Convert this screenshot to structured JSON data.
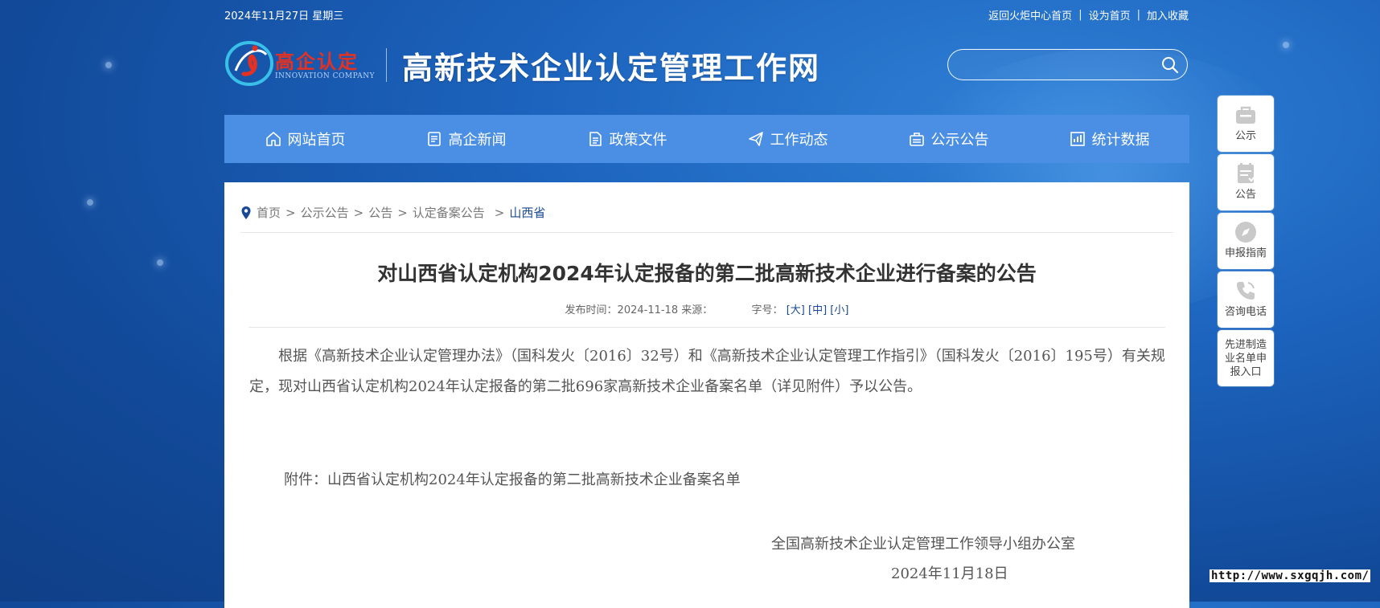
{
  "topbar": {
    "date": "2024年11月27日 星期三",
    "links": [
      "返回火炬中心首页",
      "设为首页",
      "加入收藏"
    ],
    "separator": "|"
  },
  "header": {
    "logo_text": "高企认定",
    "logo_sub": "INNOVATION COMPANY",
    "site_title": "高新技术企业认定管理工作网",
    "search_placeholder": ""
  },
  "nav": {
    "items": [
      {
        "label": "网站首页",
        "icon": "home-icon"
      },
      {
        "label": "高企新闻",
        "icon": "news-icon"
      },
      {
        "label": "政策文件",
        "icon": "document-icon"
      },
      {
        "label": "工作动态",
        "icon": "paper-plane-icon"
      },
      {
        "label": "公示公告",
        "icon": "announcement-icon"
      },
      {
        "label": "统计数据",
        "icon": "chart-icon"
      }
    ]
  },
  "breadcrumb": {
    "items": [
      "首页",
      "公示公告",
      "公告",
      "认定备案公告"
    ],
    "current": "山西省",
    "separator": ">"
  },
  "article": {
    "title": "对山西省认定机构2024年认定报备的第二批高新技术企业进行备案的公告",
    "meta_publish_label": "发布时间：",
    "meta_publish_date": "2024-11-18",
    "meta_source_label": "来源：",
    "meta_font_label": "字号：",
    "font_sizes": [
      "[大]",
      "[中]",
      "[小]"
    ],
    "paragraph": "根据《高新技术企业认定管理办法》（国科发火〔2016〕32号）和《高新技术企业认定管理工作指引》（国科发火〔2016〕195号）有关规定，现对山西省认定机构2024年认定报备的第二批696家高新技术企业备案名单（详见附件）予以公告。",
    "attachment_label": "附件：",
    "attachment_link": "山西省认定机构2024年认定报备的第二批高新技术企业备案名单",
    "signature_org": "全国高新技术企业认定管理工作领导小组办公室",
    "signature_date": "2024年11月18日"
  },
  "sidebar": {
    "items": [
      {
        "label": "公示",
        "icon": "briefcase-icon"
      },
      {
        "label": "公告",
        "icon": "notice-board-icon"
      },
      {
        "label": "申报指南",
        "icon": "compass-icon"
      },
      {
        "label": "咨询电话",
        "icon": "phone-icon"
      },
      {
        "label": "先进制造业名单申报入口",
        "icon": ""
      }
    ]
  },
  "watermark": "http://www.sxgqjh.com/",
  "colors": {
    "background": "#1c63bd",
    "nav_bar": "#4a8fe3",
    "logo_red": "#e53121",
    "breadcrumb_current": "#1a4a96"
  }
}
